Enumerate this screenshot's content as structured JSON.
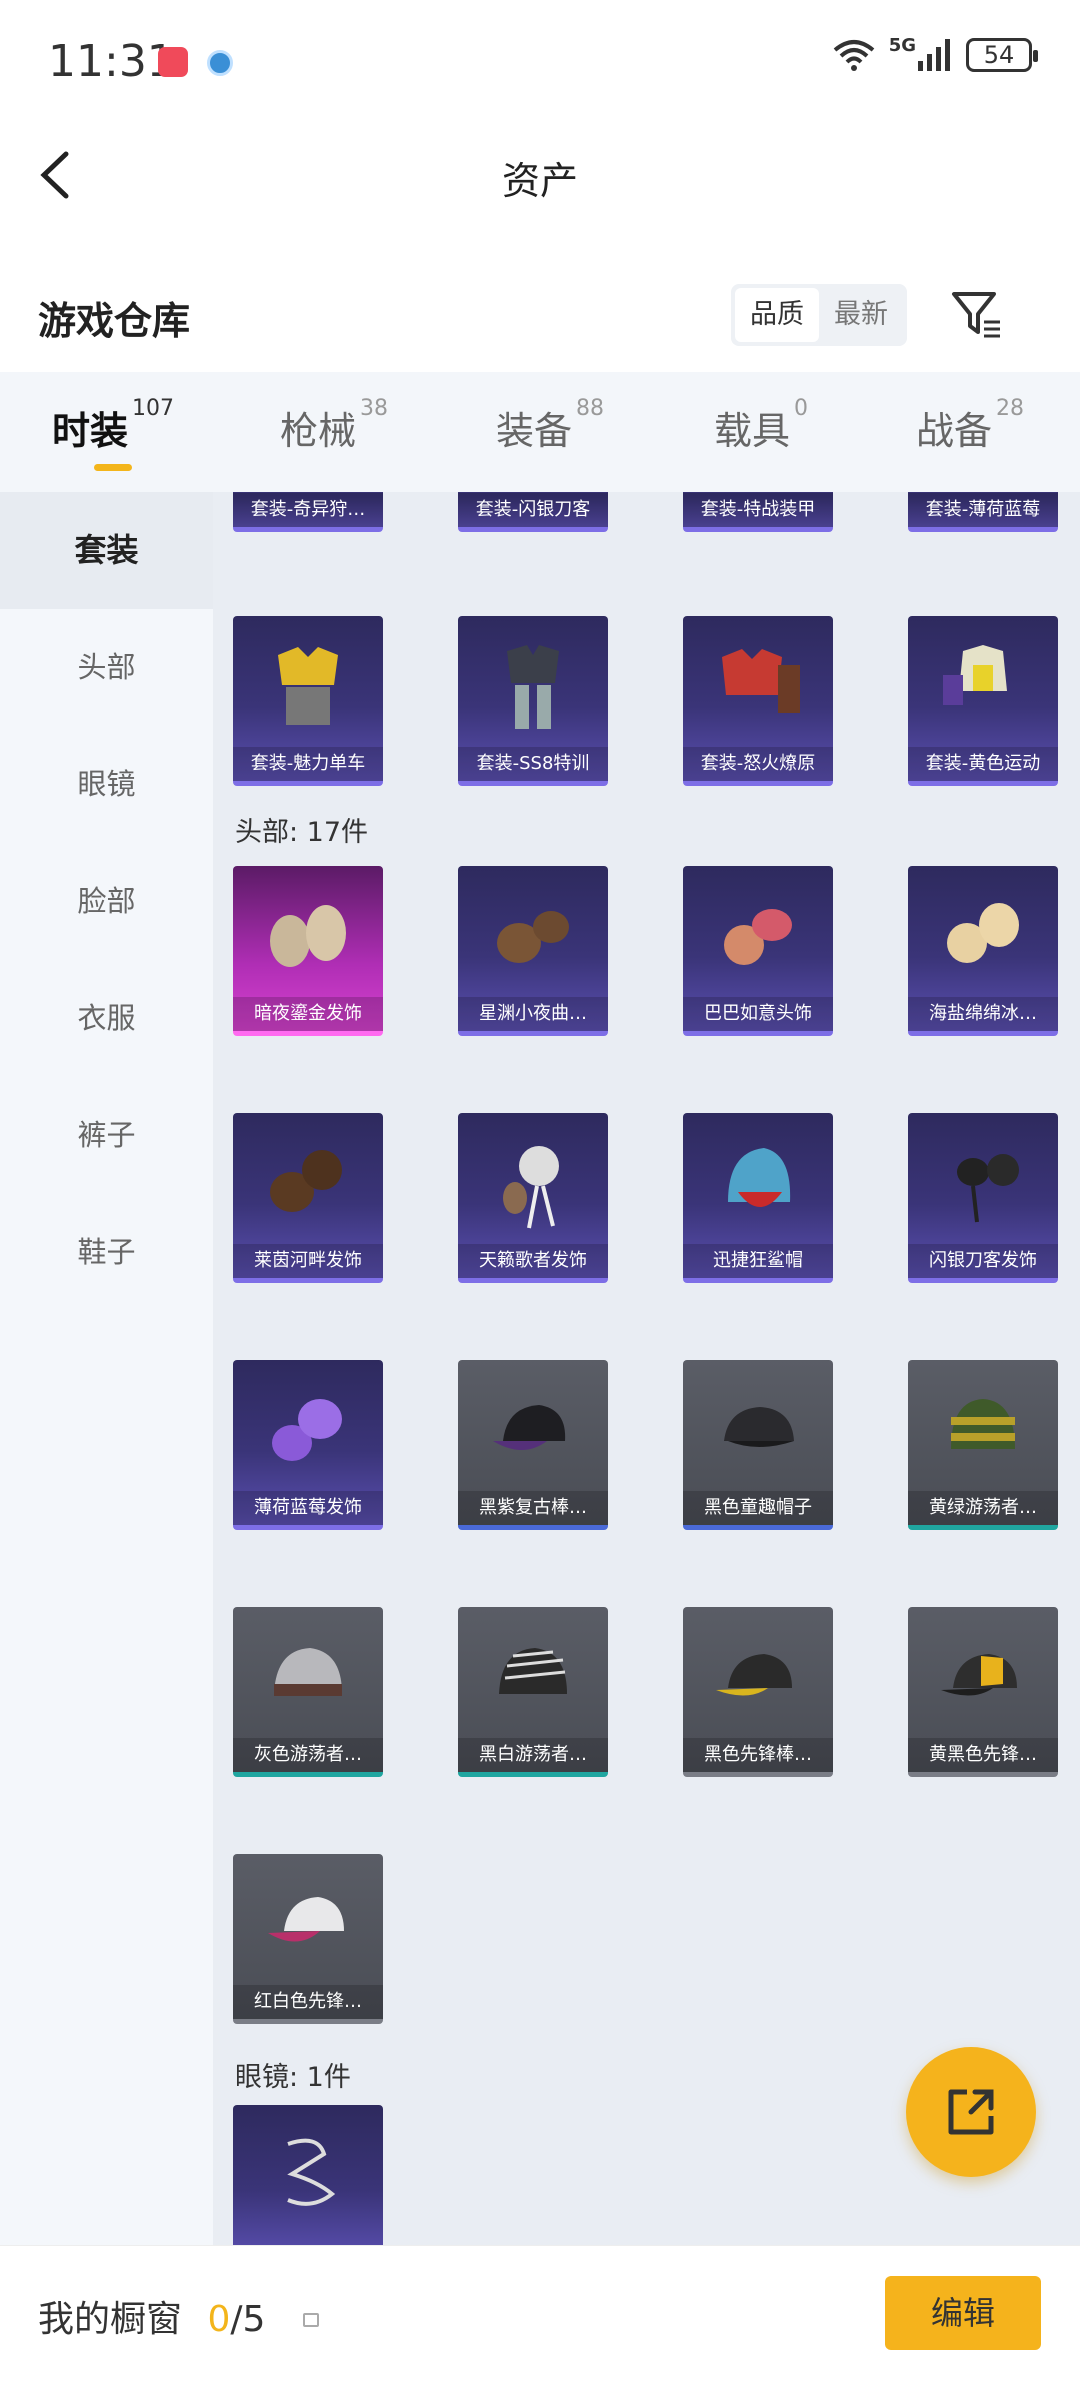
{
  "status": {
    "time": "11:31",
    "network": "5G",
    "battery": "54"
  },
  "header": {
    "title": "资产"
  },
  "warehouse": {
    "title": "游戏仓库",
    "sort_quality": "品质",
    "sort_newest": "最新"
  },
  "tabs": [
    {
      "label": "时装",
      "count": "107"
    },
    {
      "label": "枪械",
      "count": "38"
    },
    {
      "label": "装备",
      "count": "88"
    },
    {
      "label": "载具",
      "count": "0"
    },
    {
      "label": "战备",
      "count": "28"
    }
  ],
  "sidebar": [
    "套装",
    "头部",
    "眼镜",
    "脸部",
    "衣服",
    "裤子",
    "鞋子"
  ],
  "sections": {
    "head": "头部: 17件",
    "glasses": "眼镜: 1件"
  },
  "suits_row1": [
    "套装-奇异狩…",
    "套装-闪银刀客",
    "套装-特战装甲",
    "套装-薄荷蓝莓"
  ],
  "suits_row2": [
    "套装-魅力单车",
    "套装-SS8特训",
    "套装-怒火燎原",
    "套装-黄色运动"
  ],
  "head_items": [
    "暗夜鎏金发饰",
    "星渊小夜曲…",
    "巴巴如意头饰",
    "海盐绵绵冰…",
    "莱茵河畔发饰",
    "天籁歌者发饰",
    "迅捷狂鲨帽",
    "闪银刀客发饰",
    "薄荷蓝莓发饰",
    "黑紫复古棒…",
    "黑色童趣帽子",
    "黄绿游荡者…",
    "灰色游荡者…",
    "黑白游荡者…",
    "黑色先锋棒…",
    "黄黑色先锋…",
    "红白色先锋…"
  ],
  "bottom": {
    "showcase_label": "我的橱窗",
    "showcase_current": "0",
    "showcase_total": "/5",
    "edit_label": "编辑"
  },
  "colors": {
    "accent": "#f5b31c",
    "legend_card": "#3a3478",
    "mythic_card": "#d642cf"
  }
}
